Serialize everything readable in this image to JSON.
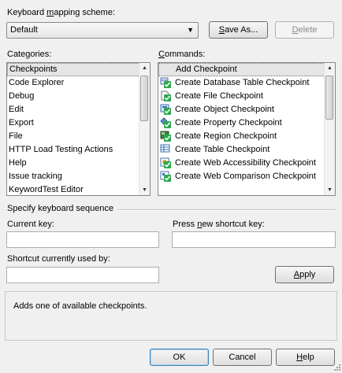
{
  "scheme": {
    "label_pre": "Keyboard ",
    "label_u": "m",
    "label_post": "apping scheme:",
    "value": "Default",
    "save_as_u": "S",
    "save_as_post": "ave As...",
    "delete_u": "D",
    "delete_post": "elete"
  },
  "categories": {
    "label": "Categories:",
    "items": [
      "Checkpoints",
      "Code Explorer",
      "Debug",
      "Edit",
      "Export",
      "File",
      "HTTP Load Testing Actions",
      "Help",
      "Issue tracking",
      "KeywordTest Editor"
    ]
  },
  "commands": {
    "label_u": "C",
    "label_post": "ommands:",
    "items": [
      {
        "label": "Add Checkpoint",
        "icon": "none"
      },
      {
        "label": "Create Database Table Checkpoint",
        "icon": "database-checkpoint-icon"
      },
      {
        "label": "Create File Checkpoint",
        "icon": "file-checkpoint-icon"
      },
      {
        "label": "Create Object Checkpoint",
        "icon": "object-checkpoint-icon"
      },
      {
        "label": "Create Property Checkpoint",
        "icon": "property-checkpoint-icon"
      },
      {
        "label": "Create Region Checkpoint",
        "icon": "region-checkpoint-icon"
      },
      {
        "label": "Create Table Checkpoint",
        "icon": "table-checkpoint-icon"
      },
      {
        "label": "Create Web Accessibility Checkpoint",
        "icon": "web-accessibility-checkpoint-icon"
      },
      {
        "label": "Create Web Comparison Checkpoint",
        "icon": "web-comparison-checkpoint-icon"
      }
    ]
  },
  "keyboard": {
    "section_label": "Specify keyboard sequence",
    "current_key_label": "Current key:",
    "current_key_value": "",
    "new_key_pre": "Press ",
    "new_key_u": "n",
    "new_key_post": "ew shortcut key:",
    "new_key_value": "",
    "used_by_label": "Shortcut currently used by:",
    "used_by_value": "",
    "apply_u": "A",
    "apply_post": "pply"
  },
  "description": "Adds one of available checkpoints.",
  "footer": {
    "ok": "OK",
    "cancel": "Cancel",
    "help_u": "H",
    "help_post": "elp"
  },
  "colors": {
    "check_green": "#2fa84f",
    "accent_blue": "#3c7fb1"
  }
}
